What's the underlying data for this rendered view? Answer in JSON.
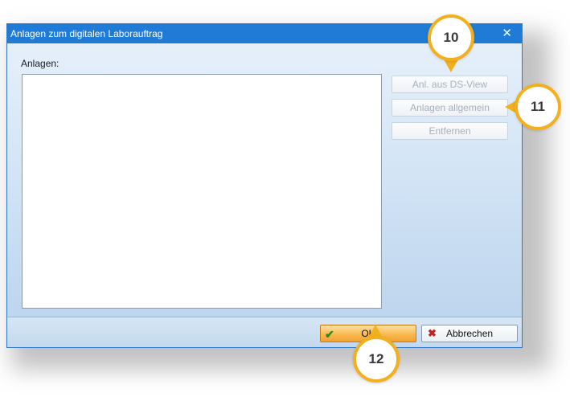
{
  "window": {
    "title": "Anlagen zum digitalen Laborauftrag",
    "close_glyph": "✕"
  },
  "attachments": {
    "label": "Anlagen:",
    "items": []
  },
  "side_buttons": [
    {
      "label": "Anl. aus DS-View",
      "enabled": false
    },
    {
      "label": "Anlagen allgemein",
      "enabled": false
    },
    {
      "label": "Entfernen",
      "enabled": false
    }
  ],
  "footer": {
    "ok_label": "OK",
    "ok_icon": "checkmark-icon",
    "cancel_label": "Abbrechen",
    "cancel_icon": "x-icon"
  },
  "callouts": [
    {
      "number": "10"
    },
    {
      "number": "11"
    },
    {
      "number": "12"
    }
  ],
  "colors": {
    "titlebar": "#1f7bd6",
    "callout_border": "#f2b01e",
    "ok_button": "#f9b94e",
    "cancel_icon": "#c82020",
    "ok_icon": "#2f8a1a"
  }
}
